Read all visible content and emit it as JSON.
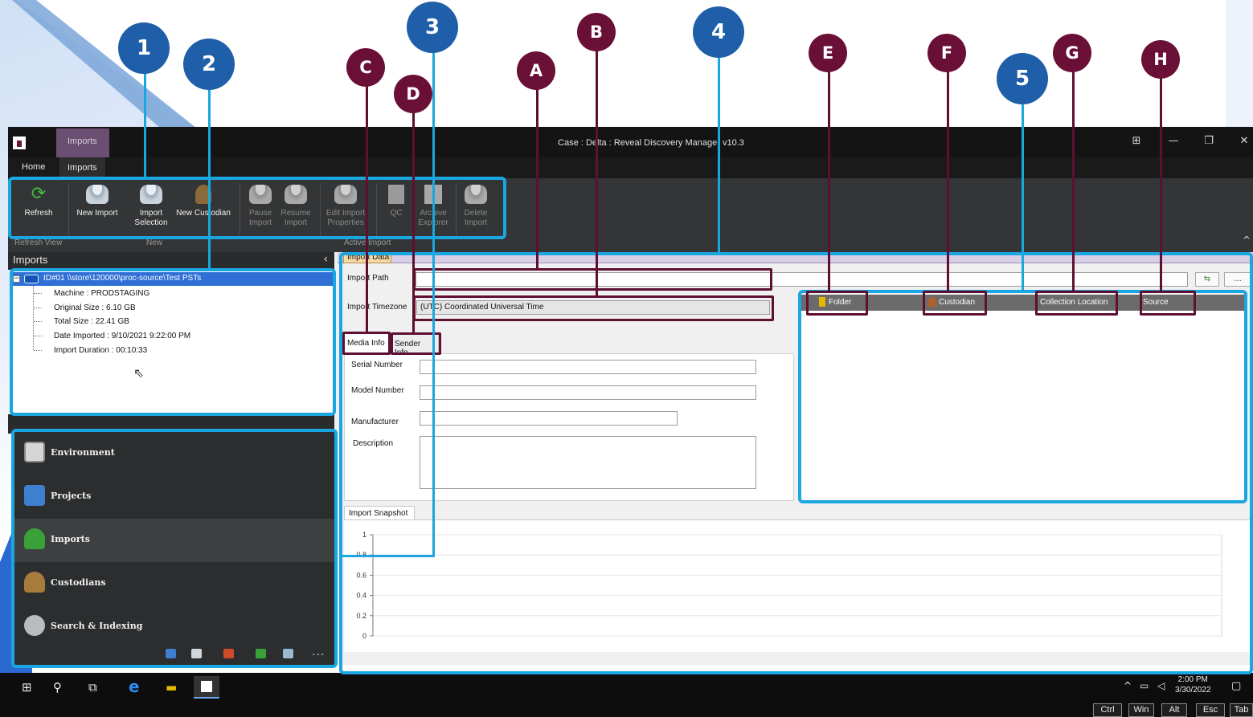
{
  "window": {
    "title": "Case : Delta : Reveal Discovery Manager  v10.3",
    "context_tab": "Imports"
  },
  "ribbon_tabs": [
    "Home",
    "Imports"
  ],
  "ribbon": {
    "buttons": [
      {
        "label": "Refresh",
        "icon": "refresh-icon",
        "enabled": true
      },
      {
        "label": "New Import",
        "icon": "new-import-icon",
        "enabled": true
      },
      {
        "label": "Import\nSelection",
        "icon": "import-selection-icon",
        "enabled": true
      },
      {
        "label": "New Custodian",
        "icon": "new-custodian-icon",
        "enabled": true
      },
      {
        "label": "Pause\nImport",
        "icon": "pause-import-icon",
        "enabled": false
      },
      {
        "label": "Resume\nImport",
        "icon": "resume-import-icon",
        "enabled": false
      },
      {
        "label": "Edit Import\nProperties",
        "icon": "edit-import-icon",
        "enabled": false
      },
      {
        "label": "QC",
        "icon": "qc-icon",
        "enabled": false
      },
      {
        "label": "Archive\nExplorer",
        "icon": "archive-explorer-icon",
        "enabled": false
      },
      {
        "label": "Delete\nImport",
        "icon": "delete-import-icon",
        "enabled": false
      }
    ],
    "groups": [
      "Refresh View",
      "New",
      "Active Import"
    ]
  },
  "imports_panel": {
    "title": "Imports",
    "root": "ID#01 \\\\store\\120000\\proc-source\\Test PSTs",
    "items": [
      "Machine : PRODSTAGING",
      "Original Size : 6.10 GB",
      "Total Size : 22.41 GB",
      "Date Imported : 9/10/2021 9:22:00 PM",
      "Import Duration : 00:10:33"
    ]
  },
  "nav": {
    "items": [
      "Environment",
      "Projects",
      "Imports",
      "Custodians",
      "Search & Indexing"
    ],
    "active": "Imports",
    "more": "..."
  },
  "main": {
    "tab": "Import Data",
    "import_path_label": "Import Path",
    "import_path_value": "",
    "timezone_label": "Import Timezone",
    "timezone_value": "(UTC) Coordinated Universal Time",
    "grid_columns": [
      "Folder",
      "Custodian",
      "Collection Location",
      "Source"
    ],
    "subtabs": [
      "Media Info",
      "Sender Info"
    ],
    "media_fields": [
      "Serial Number",
      "Model Number",
      "Manufacturer",
      "Description"
    ],
    "snapshot_tab": "Import Snapshot",
    "browse_label": "..."
  },
  "chart_data": {
    "type": "line",
    "title": "Import Snapshot",
    "x": [],
    "y_ticks": [
      "1",
      "0.8",
      "0.6",
      "0.4",
      "0.2",
      "0"
    ],
    "ylim": [
      0,
      1
    ],
    "series": [],
    "grid": true
  },
  "taskbar": {
    "time": "2:00 PM",
    "date": "3/30/2022"
  },
  "keys": [
    "Ctrl",
    "Win",
    "Alt",
    "Esc",
    "Tab"
  ],
  "callouts": {
    "numbers": [
      "1",
      "2",
      "3",
      "4",
      "5"
    ],
    "letters": [
      "A",
      "B",
      "C",
      "D",
      "E",
      "F",
      "G",
      "H"
    ]
  },
  "colors": {
    "callout_blue": "#1f5ea8",
    "callout_maroon": "#6a0f36",
    "highlight_cyan": "#1aa6e0",
    "selection_blue": "#2f6fd6"
  }
}
